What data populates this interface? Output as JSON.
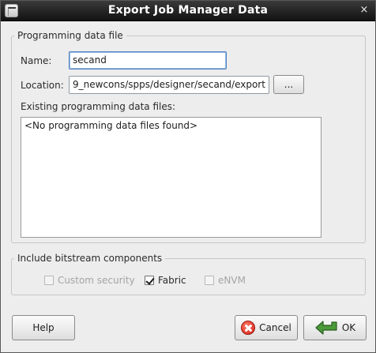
{
  "window": {
    "title": "Export Job Manager Data",
    "close_glyph": "×",
    "icon": "app-icon"
  },
  "programming_group": {
    "label": "Programming data file",
    "name_label": "Name:",
    "name_value": "secand",
    "location_label": "Location:",
    "location_value": "9_newcons/spps/designer/secand/export",
    "browse_label": "...",
    "existing_label": "Existing programming data files:",
    "existing_empty": "<No programming data files found>"
  },
  "bitstream_group": {
    "label": "Include bitstream components",
    "options": [
      {
        "label": "Custom security",
        "checked": false,
        "enabled": false
      },
      {
        "label": "Fabric",
        "checked": true,
        "enabled": true
      },
      {
        "label": "eNVM",
        "checked": false,
        "enabled": false
      }
    ]
  },
  "buttons": {
    "help": "Help",
    "cancel": "Cancel",
    "cancel_icon": "cancel-icon",
    "ok": "OK",
    "ok_icon": "ok-arrow-icon"
  },
  "colors": {
    "titlebar": "#1e1e1e",
    "focus_border": "#4c7fc0",
    "cancel_red": "#d21e12",
    "ok_green": "#3c8a2e"
  }
}
